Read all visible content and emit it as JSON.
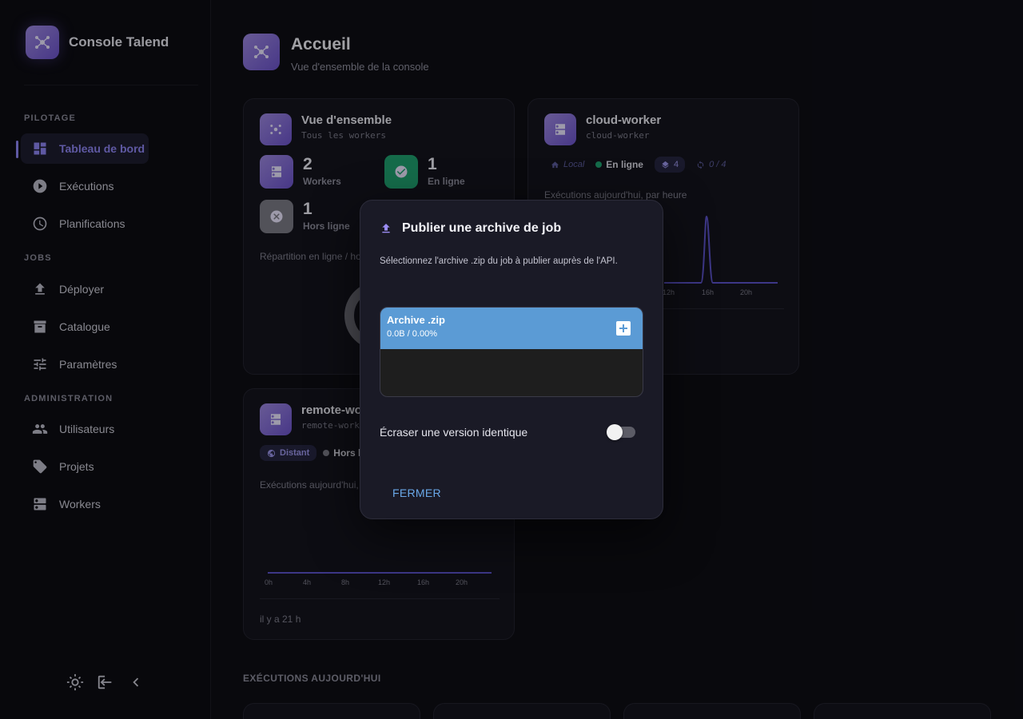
{
  "sidebar": {
    "brand": "Console Talend",
    "sections": [
      {
        "label": "PILOTAGE"
      },
      {
        "label": "JOBS"
      },
      {
        "label": "ADMINISTRATION"
      }
    ],
    "items": [
      {
        "label": "Tableau de bord",
        "icon": "dashboard-icon"
      },
      {
        "label": "Exécutions",
        "icon": "play-icon"
      },
      {
        "label": "Planifications",
        "icon": "clock-icon"
      },
      {
        "label": "Déployer",
        "icon": "upload-icon"
      },
      {
        "label": "Catalogue",
        "icon": "archive-icon"
      },
      {
        "label": "Paramètres",
        "icon": "tune-icon"
      },
      {
        "label": "Utilisateurs",
        "icon": "users-icon"
      },
      {
        "label": "Projets",
        "icon": "tag-icon"
      },
      {
        "label": "Workers",
        "icon": "dns-icon"
      }
    ]
  },
  "header": {
    "title": "Accueil",
    "subtitle": "Vue d'ensemble de la console"
  },
  "overview": {
    "title": "Vue d'ensemble",
    "subtitle": "Tous les workers",
    "stats": [
      {
        "value": "2",
        "label": "Workers"
      },
      {
        "value": "1",
        "label": "En ligne"
      },
      {
        "value": "1",
        "label": "Hors ligne"
      }
    ],
    "chart_label": "Répartition en ligne / ho"
  },
  "cloud_worker": {
    "title": "cloud-worker",
    "subtitle": "cloud-worker",
    "location": "Local",
    "status": "En ligne",
    "layers": "4",
    "sync": "0 / 4",
    "chart_label": "Exécutions aujourd'hui, par heure",
    "ticks": [
      "12h",
      "16h",
      "20h"
    ]
  },
  "remote_worker": {
    "title": "remote-wo",
    "subtitle": "remote-work",
    "location": "Distant",
    "status": "Hors li",
    "chart_label": "Exécutions aujourd'hui,",
    "ticks": [
      "0h",
      "4h",
      "8h",
      "12h",
      "16h",
      "20h"
    ],
    "footer": "il y a 21 h"
  },
  "section_title": "EXÉCUTIONS AUJOURD'HUI",
  "modal": {
    "title": "Publier une archive de job",
    "description": "Sélectionnez l'archive .zip du job à publier auprès de l'API.",
    "upload_label": "Archive .zip",
    "upload_progress": "0.0B / 0.00%",
    "toggle_label": "Écraser une version identique",
    "toggle_on": false,
    "close_label": "FERMER"
  },
  "colors": {
    "accent": "#8c84f0",
    "online": "#1f9e6e",
    "upload_header": "#5b9bd5",
    "close_button": "#6aa8e8"
  }
}
